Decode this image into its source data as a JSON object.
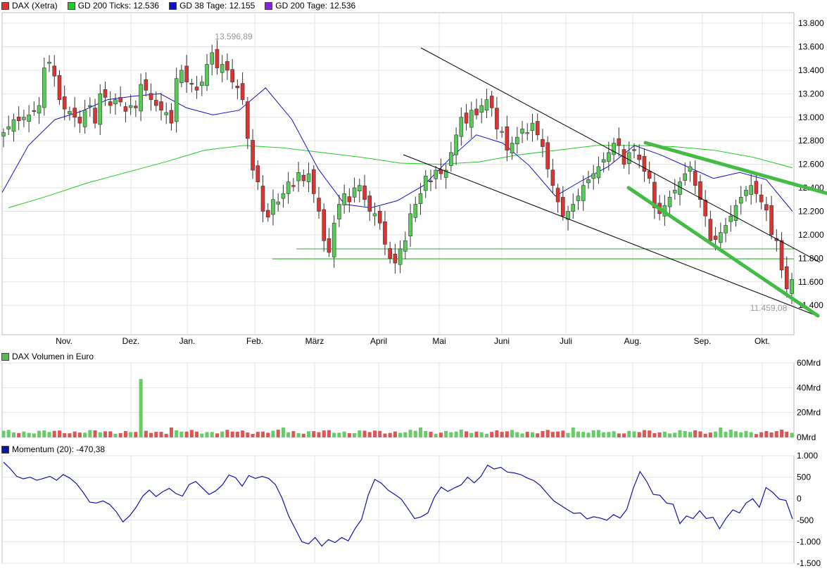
{
  "legends": {
    "price": [
      {
        "label": "DAX (Xetra)",
        "color": "#dd3333"
      },
      {
        "label": "GD 200 Ticks: 12.536",
        "color": "#22cc22"
      },
      {
        "label": "GD 38 Tage: 12.155",
        "color": "#1111cc"
      },
      {
        "label": "GD 200 Tage: 12.536",
        "color": "#8822dd"
      }
    ],
    "volume": {
      "label": "DAX Volumen in Euro",
      "color": "#55bb55"
    },
    "momentum": {
      "label": "Momentum (20): -470,38",
      "color": "#1111aa"
    }
  },
  "chart_data": [
    {
      "type": "candlestick",
      "title": "DAX (Xetra)",
      "x_tick_labels": [
        "Nov.",
        "Dez.",
        "Jan.",
        "Feb.",
        "März",
        "April",
        "Mai",
        "Juni",
        "Juli",
        "Aug.",
        "Sep.",
        "Okt."
      ],
      "y_tick_labels": [
        "13.800",
        "13.600",
        "13.400",
        "13.200",
        "13.000",
        "12.800",
        "12.600",
        "12.400",
        "12.200",
        "12.000",
        "11.800",
        "11.600",
        "11.400"
      ],
      "y_ticks": [
        13800,
        13600,
        13400,
        13200,
        13000,
        12800,
        12600,
        12400,
        12200,
        12000,
        11800,
        11600,
        11400
      ],
      "ylim": [
        11150,
        13890
      ],
      "grid": true,
      "annotations": {
        "high": "13.596,89",
        "low": "11.459,08"
      },
      "close_approx": [
        12870,
        12920,
        12980,
        12970,
        13000,
        13020,
        13050,
        13100,
        13420,
        13470,
        13350,
        13150,
        13070,
        13050,
        13000,
        12950,
        13060,
        13100,
        12950,
        13200,
        13170,
        13100,
        13150,
        13130,
        13050,
        13100,
        13080,
        13280,
        13230,
        13150,
        13100,
        13060,
        13040,
        12950,
        13330,
        13400,
        13300,
        13280,
        13230,
        13300,
        13450,
        13550,
        13420,
        13450,
        13400,
        13300,
        13250,
        13150,
        12820,
        12550,
        12450,
        12200,
        12150,
        12300,
        12280,
        12350,
        12450,
        12420,
        12530,
        12460,
        12520,
        12350,
        12200,
        11950,
        11850,
        12100,
        12260,
        12350,
        12280,
        12400,
        12420,
        12300,
        12200,
        12180,
        12100,
        11920,
        11800,
        11760,
        11880,
        11950,
        12180,
        12260,
        12350,
        12500,
        12450,
        12550,
        12520,
        12550,
        12700,
        12850,
        13000,
        12950,
        13060,
        13020,
        13100,
        13150,
        13080,
        12900,
        12880,
        12720,
        12780,
        12830,
        12900,
        12870,
        12950,
        12850,
        12750,
        12560,
        12420,
        12280,
        12160,
        12200,
        12260,
        12330,
        12420,
        12470,
        12520,
        12580,
        12640,
        12700,
        12780,
        12760,
        12600,
        12700,
        12720,
        12640,
        12540,
        12480,
        12230,
        12180,
        12250,
        12320,
        12380,
        12450,
        12520,
        12580,
        12420,
        12300,
        12160,
        11950,
        11960,
        12020,
        12080,
        12160,
        12250,
        12320,
        12380,
        12420,
        12350,
        12280,
        12210,
        12000,
        11950,
        11700,
        11540,
        11620
      ],
      "series": [
        {
          "name": "GD 200 Tage: 12.536",
          "values": [
            12230,
            12330,
            12440,
            12530,
            12620,
            12720,
            12760,
            12740,
            12700,
            12660,
            12610,
            12600,
            12620,
            12680,
            12720,
            12760,
            12760,
            12750,
            12720,
            12660,
            12570
          ]
        },
        {
          "name": "GD 38 Tage: 12.155",
          "values": [
            12360,
            12760,
            12980,
            13050,
            13150,
            13180,
            13200,
            13080,
            13020,
            13060,
            13250,
            12980,
            12560,
            12260,
            12230,
            12290,
            12420,
            12650,
            12850,
            12780,
            12590,
            12330,
            12460,
            12580,
            12760,
            12680,
            12580,
            12480,
            12530,
            12470,
            12200
          ]
        }
      ]
    },
    {
      "type": "bar",
      "title": "DAX Volumen in Euro",
      "y_tick_labels": [
        "60Mrd",
        "40Mrd",
        "20Mrd",
        "0Mrd"
      ],
      "y_ticks": [
        60,
        40,
        20,
        0
      ],
      "ylim": [
        0,
        60
      ],
      "approx_typical_volume_bn": 4.5,
      "notable_spikes_bn": [
        47,
        11,
        10,
        12
      ]
    },
    {
      "type": "line",
      "title": "Momentum (20): -470,38",
      "y_tick_labels": [
        "1.000",
        "500",
        "0",
        "-500",
        "-1.000",
        "-1.500"
      ],
      "y_ticks": [
        1000,
        500,
        0,
        -500,
        -1000,
        -1500
      ],
      "ylim": [
        -1500,
        1000
      ],
      "values": [
        850,
        700,
        520,
        460,
        500,
        430,
        470,
        520,
        430,
        560,
        480,
        350,
        150,
        -80,
        -100,
        -50,
        -130,
        -300,
        -540,
        -400,
        -200,
        60,
        200,
        50,
        160,
        240,
        120,
        60,
        330,
        400,
        250,
        100,
        180,
        320,
        550,
        490,
        290,
        540,
        470,
        520,
        470,
        330,
        20,
        -400,
        -700,
        -1000,
        -1050,
        -900,
        -1100,
        -950,
        -1020,
        -900,
        -980,
        -700,
        -480,
        80,
        450,
        360,
        200,
        100,
        -10,
        -230,
        -460,
        -420,
        -330,
        40,
        270,
        170,
        250,
        320,
        500,
        370,
        520,
        780,
        690,
        730,
        620,
        600,
        560,
        480,
        420,
        300,
        120,
        -50,
        -150,
        -250,
        -340,
        -330,
        -470,
        -420,
        -450,
        -500,
        -370,
        -450,
        -250,
        250,
        630,
        400,
        100,
        80,
        -100,
        -130,
        -580,
        -400,
        -460,
        -280,
        -460,
        -430,
        -700,
        -450,
        -260,
        -330,
        -100,
        0,
        -200,
        260,
        150,
        -10,
        -40,
        -470
      ]
    }
  ]
}
